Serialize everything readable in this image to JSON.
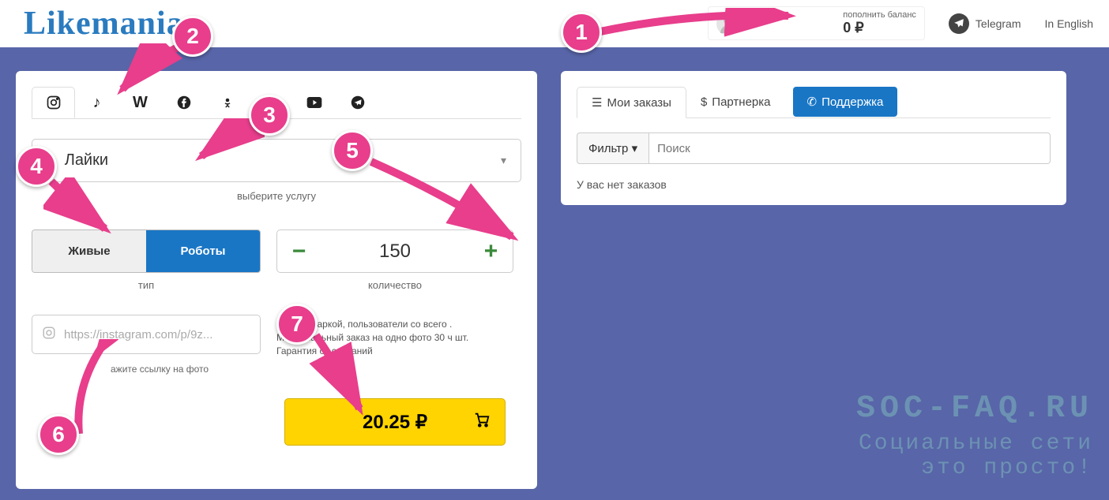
{
  "logo": "Likemania",
  "header": {
    "balance_label": "пополнить баланс",
    "balance_value": "0 ₽",
    "telegram": "Telegram",
    "lang": "In English"
  },
  "left": {
    "service_name": "Лайки",
    "service_hint": "выберите услугу",
    "type_live": "Живые",
    "type_bot": "Роботы",
    "type_label": "тип",
    "qty_value": "150",
    "qty_label": "количество",
    "url_placeholder": "https://instagram.com/p/9z...",
    "url_label": "ажите ссылку на фото",
    "desc": "ты с аватаркой, пользователи со всего . Максимальный заказ на одно фото 30 ч шт. Гарантия от списаний",
    "price": "20.25 ₽"
  },
  "right": {
    "tab_orders": "Мои заказы",
    "tab_partner": "Партнерка",
    "tab_support": "Поддержка",
    "filter": "Фильтр",
    "search_placeholder": "Поиск",
    "empty": "У вас нет заказов"
  },
  "watermark": {
    "line1": "SOC-FAQ.RU",
    "line2": "Социальные сети",
    "line3": "это просто!"
  },
  "annotations": [
    "1",
    "2",
    "3",
    "4",
    "5",
    "6",
    "7"
  ]
}
